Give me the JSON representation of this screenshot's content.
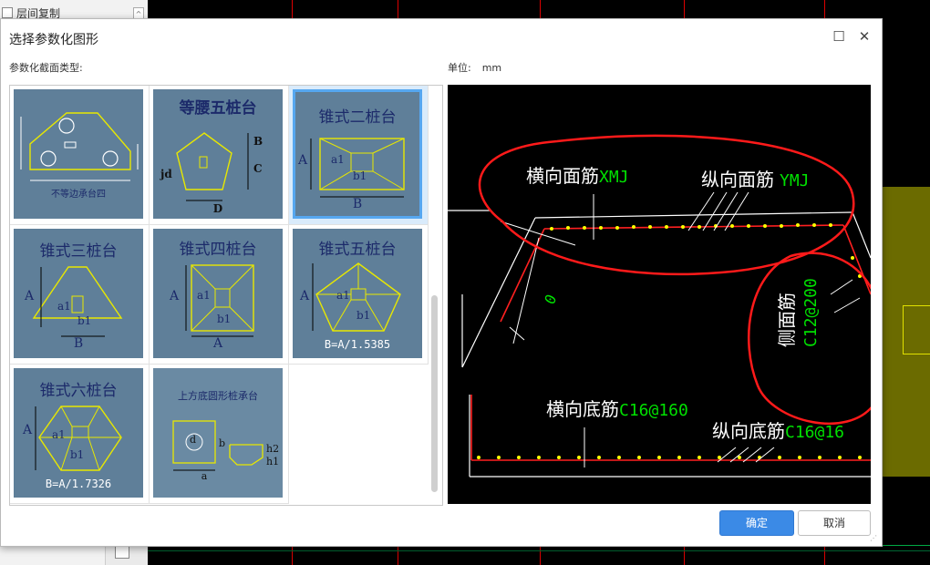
{
  "background": {
    "left_panel_item": "层间复制"
  },
  "dialog": {
    "title": "选择参数化图形",
    "section_label": "参数化截面类型:",
    "unit_label": "单位:",
    "unit_value": "mm",
    "ok_label": "确定",
    "cancel_label": "取消"
  },
  "shapes": [
    {
      "label": "不等边承台四"
    },
    {
      "label": "等腰五桩台",
      "dims": [
        "B",
        "C",
        "jd",
        "D"
      ]
    },
    {
      "label": "锥式二桩台",
      "dims": [
        "A",
        "a1",
        "b1",
        "B"
      ]
    },
    {
      "label": "锥式三桩台",
      "dims": [
        "A",
        "a1",
        "b1",
        "B"
      ]
    },
    {
      "label": "锥式四桩台",
      "dims": [
        "A",
        "a1",
        "b1",
        "A"
      ]
    },
    {
      "label": "锥式五桩台",
      "dims": [
        "A",
        "a1",
        "b1"
      ],
      "note": "B=A/1.5385"
    },
    {
      "label": "锥式六桩台",
      "dims": [
        "A",
        "a1",
        "b1"
      ],
      "note": "B=A/1.7326"
    },
    {
      "label": "上方底圆形桩承台",
      "dims": [
        "d",
        "b",
        "a",
        "h2",
        "h1"
      ]
    }
  ],
  "preview": {
    "top_transverse_label": "横向面筋",
    "top_transverse_code": "XMJ",
    "top_longitudinal_label": "纵向面筋",
    "top_longitudinal_code": "YMJ",
    "side_label": "侧面筋",
    "side_code": "C12@200",
    "bottom_transverse_label": "横向底筋",
    "bottom_transverse_code": "C16@160",
    "bottom_longitudinal_label": "纵向底筋",
    "bottom_longitudinal_code": "C16@16",
    "dim_zero": "0"
  },
  "colors": {
    "thumb_bg": "#5f7f99",
    "selected_border": "#56a7f0",
    "primary_button": "#3b8ae6",
    "annotation_red": "#ff2020",
    "code_green": "#00e000",
    "rebar_dot": "#ffff00"
  }
}
